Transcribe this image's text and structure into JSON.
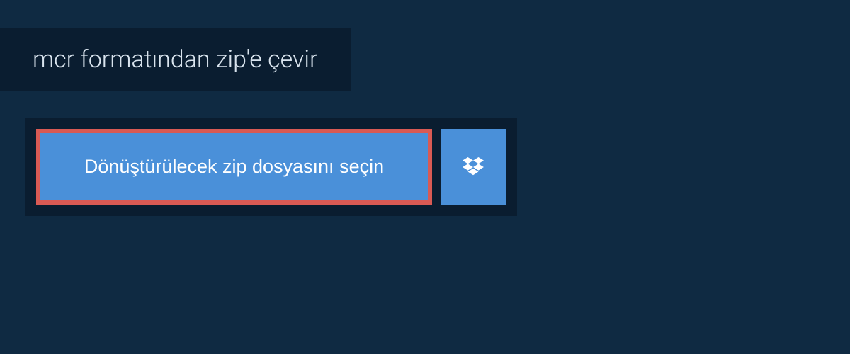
{
  "header": {
    "title": "mcr formatından zip'e çevir"
  },
  "upload": {
    "select_file_label": "Dönüştürülecek zip dosyasını seçin"
  },
  "colors": {
    "page_bg": "#0f2a42",
    "panel_bg": "#0a1d30",
    "button_bg": "#4a90d9",
    "button_border": "#d95a54",
    "text_light": "#d9e4ee",
    "text_white": "#ffffff"
  }
}
